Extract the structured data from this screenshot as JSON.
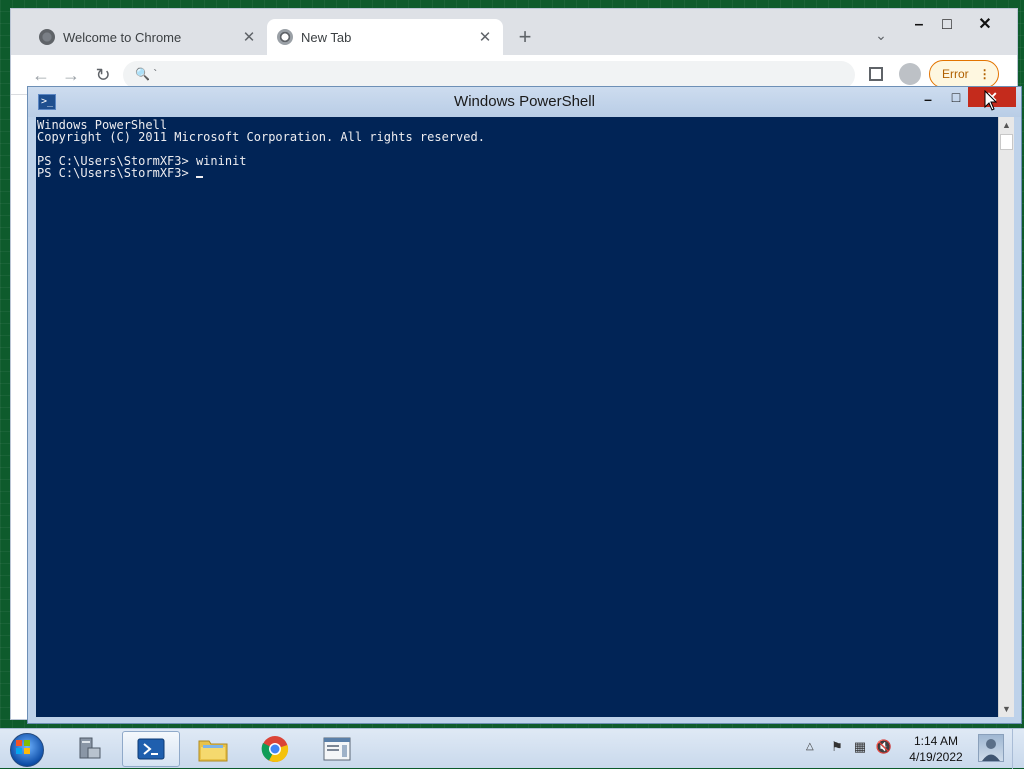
{
  "chrome": {
    "tabs": [
      {
        "label": "Welcome to Chrome",
        "close": "✕"
      },
      {
        "label": "New Tab",
        "close": "✕"
      }
    ],
    "new_tab": "+",
    "tab_search": "⌄",
    "window_controls": {
      "minimize": "–",
      "maximize": "□",
      "close": "✕"
    },
    "toolbar": {
      "back": "←",
      "forward": "→",
      "reload": "↻",
      "search_glyph": "🔍 `"
    },
    "error_chip": {
      "label": "Error",
      "menu": "⋮"
    }
  },
  "powershell": {
    "title": "Windows PowerShell",
    "controls": {
      "minimize": "–",
      "maximize": "□",
      "close": "✕"
    },
    "icon_glyph": ">_",
    "console_lines": [
      "Windows PowerShell",
      "Copyright (C) 2011 Microsoft Corporation. All rights reserved.",
      "",
      "PS C:\\Users\\StormXF3> wininit",
      "PS C:\\Users\\StormXF3> "
    ],
    "scrollbar": {
      "up": "▲",
      "down": "▼"
    }
  },
  "taskbar": {
    "buttons": [
      {
        "name": "server-manager",
        "glyph": "🖥"
      },
      {
        "name": "powershell",
        "glyph": ">_"
      },
      {
        "name": "file-explorer",
        "glyph": "📁"
      },
      {
        "name": "chrome",
        "glyph": "◉"
      },
      {
        "name": "app-window",
        "glyph": "▤"
      }
    ],
    "tray": {
      "expand": "△",
      "flag": "⚑",
      "network": "▦",
      "volume": "🔇"
    },
    "clock": {
      "time": "1:14 AM",
      "date": "4/19/2022"
    }
  },
  "colors": {
    "console_bg": "#012456",
    "console_fg": "#eeedf0",
    "close_red": "#c42b1c",
    "error_orange": "#e37400"
  }
}
